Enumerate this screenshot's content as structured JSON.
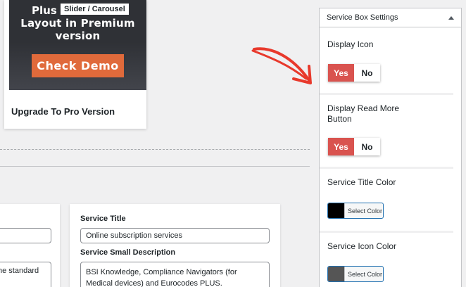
{
  "promo": {
    "line_top": "Plus",
    "badge": "Slider / Carousel",
    "line_mid": "Layout in Premium",
    "line_bottom": "version",
    "demo_button": "Check Demo",
    "card_title": "Upgrade To Pro Version"
  },
  "left_card": {
    "textarea_value": "he standard"
  },
  "service": {
    "title_label": "Service Title",
    "title_value": "Online subscription services",
    "desc_label": "Service Small Description",
    "desc_value": "BSI Knowledge, Compliance Navigators (for Medical devices) and Eurocodes PLUS."
  },
  "panel": {
    "title": "Service Box Settings",
    "display_icon_label": "Display Icon",
    "display_icon_yes": "Yes",
    "display_icon_no": "No",
    "read_more_label": "Display Read More Button",
    "read_more_yes": "Yes",
    "read_more_no": "No",
    "title_color_label": "Service Title Color",
    "title_color_button": "Select Color",
    "title_color_value": "#000000",
    "icon_color_label": "Service Icon Color",
    "icon_color_button": "Select Color",
    "icon_color_value": "#555555"
  },
  "colors": {
    "toggle_active": "#d9534f",
    "demo_button": "#e06a3b",
    "arrow": "#e8392c"
  }
}
